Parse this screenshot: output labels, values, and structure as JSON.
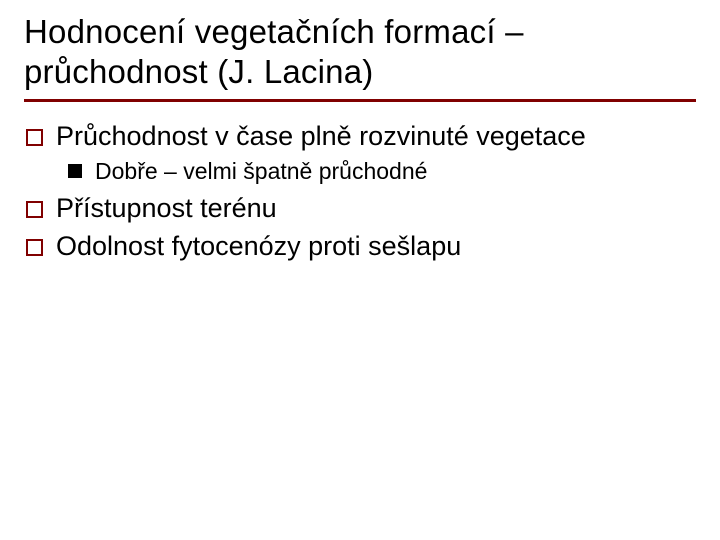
{
  "title": "Hodnocení vegetačních formací – průchodnost (J. Lacina)",
  "items": [
    {
      "level": 1,
      "text": "Průchodnost v čase plně rozvinuté vegetace"
    },
    {
      "level": 2,
      "text": "Dobře – velmi špatně průchodné"
    },
    {
      "level": 1,
      "text": "Přístupnost terénu"
    },
    {
      "level": 1,
      "text": "Odolnost fytocenózy proti sešlapu"
    }
  ]
}
